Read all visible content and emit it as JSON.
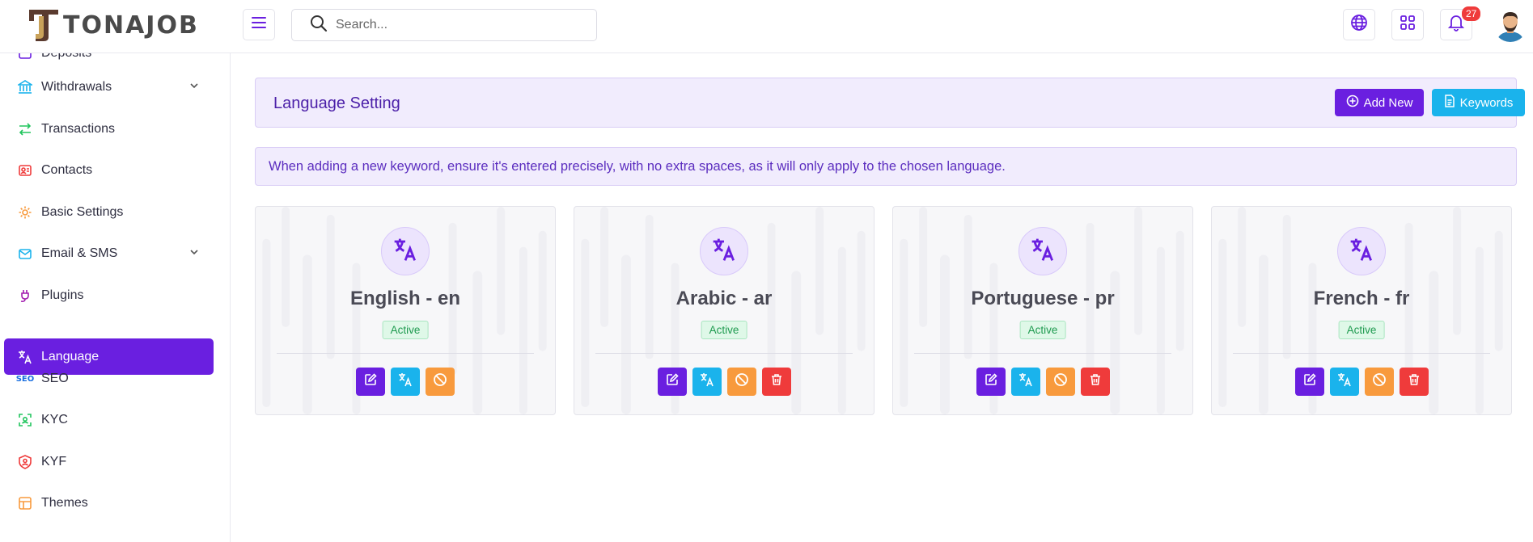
{
  "brand": {
    "name": "TONAJOB",
    "mark_letter": "J"
  },
  "search": {
    "placeholder": "Search..."
  },
  "notifications": {
    "count": "27"
  },
  "sidebar": {
    "items": [
      {
        "label": "Deposits",
        "icon": "deposit-icon",
        "has_chevron": false
      },
      {
        "label": "Withdrawals",
        "icon": "bank-icon",
        "has_chevron": true
      },
      {
        "label": "Transactions",
        "icon": "arrows-exchange-icon",
        "has_chevron": false
      },
      {
        "label": "Contacts",
        "icon": "contact-card-icon",
        "has_chevron": false
      },
      {
        "label": "Basic Settings",
        "icon": "gear-icon",
        "has_chevron": false
      },
      {
        "label": "Email & SMS",
        "icon": "mail-icon",
        "has_chevron": true
      },
      {
        "label": "Plugins",
        "icon": "plug-icon",
        "has_chevron": false
      },
      {
        "label": "Language",
        "icon": "translate-icon",
        "has_chevron": false,
        "active": true
      },
      {
        "label": "SEO",
        "icon": "seo-icon",
        "has_chevron": false
      },
      {
        "label": "KYC",
        "icon": "scan-face-icon",
        "has_chevron": false
      },
      {
        "label": "KYF",
        "icon": "shield-user-icon",
        "has_chevron": false
      },
      {
        "label": "Themes",
        "icon": "layout-icon",
        "has_chevron": false
      }
    ]
  },
  "page": {
    "title": "Language Setting",
    "add_new_label": "Add New",
    "keywords_label": "Keywords",
    "notice": "When adding a new keyword, ensure it's entered precisely, with no extra spaces, as it will only apply to the chosen language."
  },
  "languages": [
    {
      "name": "English - en",
      "status": "Active",
      "deletable": false
    },
    {
      "name": "Arabic - ar",
      "status": "Active",
      "deletable": true
    },
    {
      "name": "Portuguese - pr",
      "status": "Active",
      "deletable": true
    },
    {
      "name": "French - fr",
      "status": "Active",
      "deletable": true
    }
  ],
  "colors": {
    "primary": "#6a1fe0",
    "info": "#1ab3ec",
    "warning": "#f89a3d",
    "danger": "#ef3b3b",
    "success": "#1e9a4f"
  }
}
